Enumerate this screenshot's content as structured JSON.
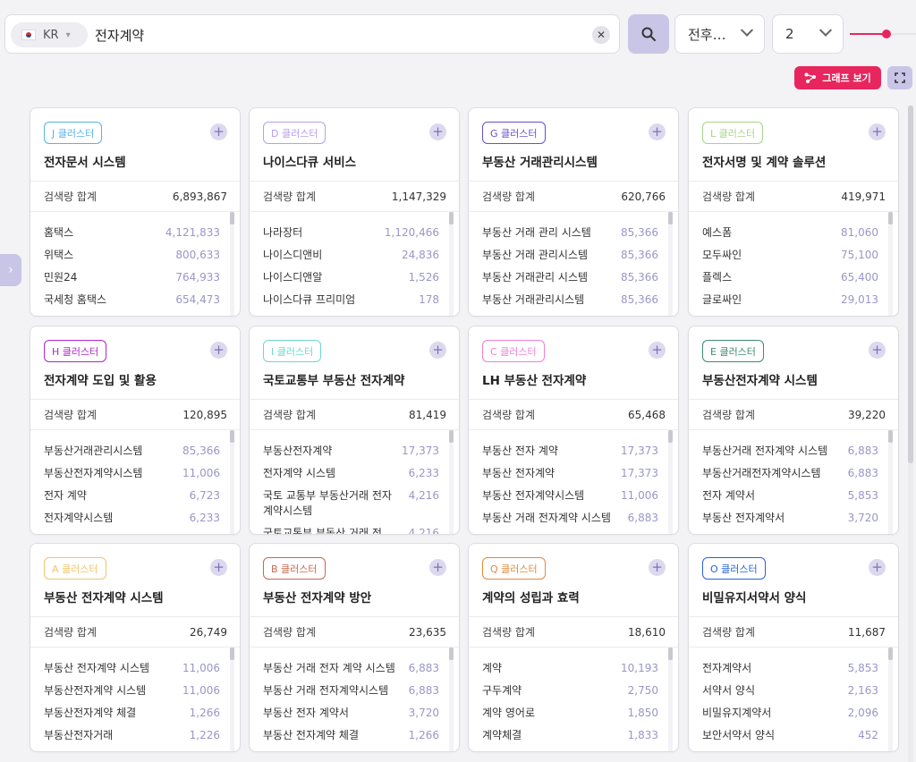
{
  "search": {
    "country_code": "KR",
    "query": "전자계약",
    "period_label": "전후…",
    "depth_value": "2",
    "depth_level": 0.55
  },
  "toolbar": {
    "graph_button_label": "그래프 보기"
  },
  "colors": {
    "accent": "#e8265e",
    "muted_purple": "#c9c5e6"
  },
  "cards": [
    {
      "badge": "J 클러스터",
      "badge_color": "#56b3e8",
      "title": "전자문서 시스템",
      "total_label": "검색량 합계",
      "total": "6,893,867",
      "rows": [
        {
          "k": "홈택스",
          "v": "4,121,833"
        },
        {
          "k": "위택스",
          "v": "800,633"
        },
        {
          "k": "민원24",
          "v": "764,933"
        },
        {
          "k": "국세청 홈택스",
          "v": "654,473"
        }
      ]
    },
    {
      "badge": "D 클러스터",
      "badge_color": "#b69ef0",
      "title": "나이스다큐 서비스",
      "total_label": "검색량 합계",
      "total": "1,147,329",
      "rows": [
        {
          "k": "나라장터",
          "v": "1,120,466"
        },
        {
          "k": "나이스디앤비",
          "v": "24,836"
        },
        {
          "k": "나이스디앤알",
          "v": "1,526"
        },
        {
          "k": "나이스다큐 프리미엄",
          "v": "178"
        }
      ]
    },
    {
      "badge": "G 클러스터",
      "badge_color": "#6a4fc9",
      "title": "부동산 거래관리시스템",
      "total_label": "검색량 합계",
      "total": "620,766",
      "rows": [
        {
          "k": "부동산 거래 관리 시스템",
          "v": "85,366"
        },
        {
          "k": "부동산 거래 관리시스템",
          "v": "85,366"
        },
        {
          "k": "부동산 거래관리 시스템",
          "v": "85,366"
        },
        {
          "k": "부동산 거래관리시스템",
          "v": "85,366"
        }
      ]
    },
    {
      "badge": "L 클러스터",
      "badge_color": "#a8d38c",
      "title": "전자서명 및 계약 솔루션",
      "total_label": "검색량 합계",
      "total": "419,971",
      "rows": [
        {
          "k": "예스폼",
          "v": "81,060"
        },
        {
          "k": "모두싸인",
          "v": "75,100"
        },
        {
          "k": "플렉스",
          "v": "65,400"
        },
        {
          "k": "글로싸인",
          "v": "29,013"
        }
      ]
    },
    {
      "badge": "H 클러스터",
      "badge_color": "#b026c9",
      "title": "전자계약 도입 및 활용",
      "total_label": "검색량 합계",
      "total": "120,895",
      "rows": [
        {
          "k": "부동산거래관리시스템",
          "v": "85,366"
        },
        {
          "k": "부동산전자계약시스템",
          "v": "11,006"
        },
        {
          "k": "전자 계약",
          "v": "6,723"
        },
        {
          "k": "전자계약시스템",
          "v": "6,233"
        }
      ]
    },
    {
      "badge": "I 클러스터",
      "badge_color": "#6fd6cf",
      "title": "국토교통부 부동산 전자계약",
      "total_label": "검색량 합계",
      "total": "81,419",
      "rows": [
        {
          "k": "부동산전자계약",
          "v": "17,373"
        },
        {
          "k": "전자계약 시스템",
          "v": "6,233"
        },
        {
          "k": "국토 교통부 부동산거래 전자계약시스템",
          "v": "4,216"
        },
        {
          "k": "국토교통부 부동산 거래 전",
          "v": "4,216"
        }
      ]
    },
    {
      "badge": "C 클러스터",
      "badge_color": "#f07fd6",
      "title": "LH 부동산 전자계약",
      "total_label": "검색량 합계",
      "total": "65,468",
      "rows": [
        {
          "k": "부동산 전자 계약",
          "v": "17,373"
        },
        {
          "k": "부동산 전자계약",
          "v": "17,373"
        },
        {
          "k": "부동산 전자계약시스템",
          "v": "11,006"
        },
        {
          "k": "부동산 거래 전자계약 시스템",
          "v": "6,883"
        }
      ]
    },
    {
      "badge": "E 클러스터",
      "badge_color": "#3f8a72",
      "title": "부동산전자계약 시스템",
      "total_label": "검색량 합계",
      "total": "39,220",
      "rows": [
        {
          "k": "부동산거래 전자계약 시스템",
          "v": "6,883"
        },
        {
          "k": "부동산거래전자계약시스템",
          "v": "6,883"
        },
        {
          "k": "전자 계약서",
          "v": "5,853"
        },
        {
          "k": "부동산 전자계약서",
          "v": "3,720"
        }
      ]
    },
    {
      "badge": "A 클러스터",
      "badge_color": "#f0c56a",
      "title": "부동산 전자계약 시스템",
      "total_label": "검색량 합계",
      "total": "26,749",
      "rows": [
        {
          "k": "부동산 전자계약 시스템",
          "v": "11,006"
        },
        {
          "k": "부동산전자계약 시스템",
          "v": "11,006"
        },
        {
          "k": "부동산전자계약 체결",
          "v": "1,266"
        },
        {
          "k": "부동산전자거래",
          "v": "1,226"
        }
      ]
    },
    {
      "badge": "B 클러스터",
      "badge_color": "#c8674e",
      "title": "부동산 전자계약 방안",
      "total_label": "검색량 합계",
      "total": "23,635",
      "rows": [
        {
          "k": "부동산 거래 전자 계약 시스템",
          "v": "6,883"
        },
        {
          "k": "부동산 거래 전자계약시스템",
          "v": "6,883"
        },
        {
          "k": "부동산 전자 계약서",
          "v": "3,720"
        },
        {
          "k": "부동산 전자계약 체결",
          "v": "1,266"
        }
      ]
    },
    {
      "badge": "Q 클러스터",
      "badge_color": "#e08a3c",
      "title": "계약의 성립과 효력",
      "total_label": "검색량 합계",
      "total": "18,610",
      "rows": [
        {
          "k": "계약",
          "v": "10,193"
        },
        {
          "k": "구두계약",
          "v": "2,750"
        },
        {
          "k": "계약 영어로",
          "v": "1,850"
        },
        {
          "k": "계약체결",
          "v": "1,833"
        }
      ]
    },
    {
      "badge": "O 클러스터",
      "badge_color": "#2563d9",
      "title": "비밀유지서약서 양식",
      "total_label": "검색량 합계",
      "total": "11,687",
      "rows": [
        {
          "k": "전자계약서",
          "v": "5,853"
        },
        {
          "k": "서약서 양식",
          "v": "2,163"
        },
        {
          "k": "비밀유지계약서",
          "v": "2,096"
        },
        {
          "k": "보안서약서 양식",
          "v": "452"
        }
      ]
    }
  ]
}
